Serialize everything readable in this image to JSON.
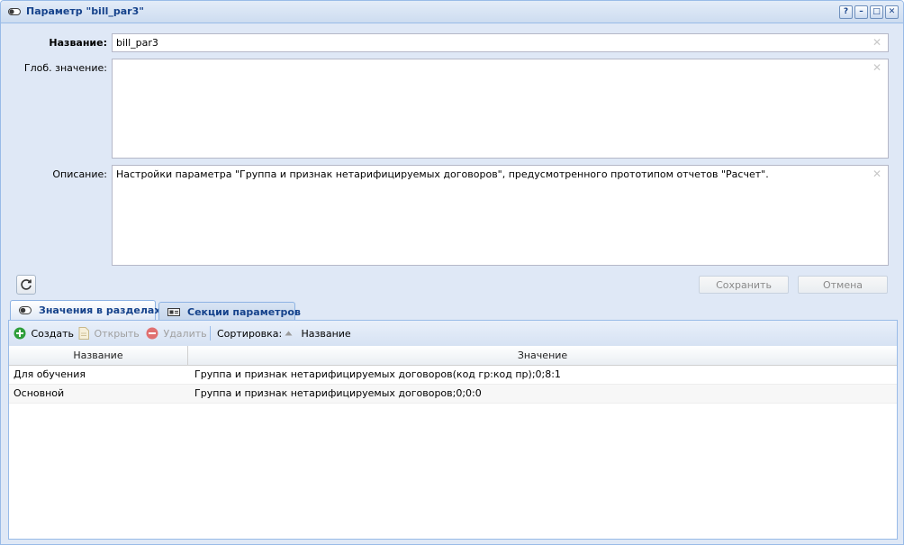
{
  "window": {
    "title": "Параметр \"bill_par3\"",
    "tools": [
      "?",
      "–",
      "□",
      "✕"
    ]
  },
  "form": {
    "name_label": "Название:",
    "name_value": "bill_par3",
    "global_label": "Глоб. значение:",
    "global_value": "",
    "desc_label": "Описание:",
    "desc_value": "Настройки параметра \"Группа и признак нетарифицируемых договоров\", предусмотренного прототипом отчетов \"Расчет\".",
    "clear_glyph": "✕"
  },
  "buttons": {
    "save": "Сохранить",
    "cancel": "Отмена"
  },
  "tabs": [
    {
      "label": "Значения в разделах",
      "active": true
    },
    {
      "label": "Секции параметров",
      "active": false
    }
  ],
  "toolbar": {
    "create": "Создать",
    "open": "Открыть",
    "delete": "Удалить",
    "sort_label": "Сортировка:",
    "sort_field": "Название"
  },
  "grid": {
    "columns": [
      "Название",
      "Значение"
    ],
    "rows": [
      {
        "name": "Для обучения",
        "value": "Группа и признак нетарифицируемых договоров(код гр:код пр);0;8:1"
      },
      {
        "name": "Основной",
        "value": "Группа и признак нетарифицируемых договоров;0;0:0"
      }
    ]
  },
  "colors": {
    "accent": "#15428b",
    "border": "#99bbe8",
    "panel_bg": "#dfe8f6",
    "create_green": "#2e9e3a",
    "delete_red": "#e07070"
  }
}
